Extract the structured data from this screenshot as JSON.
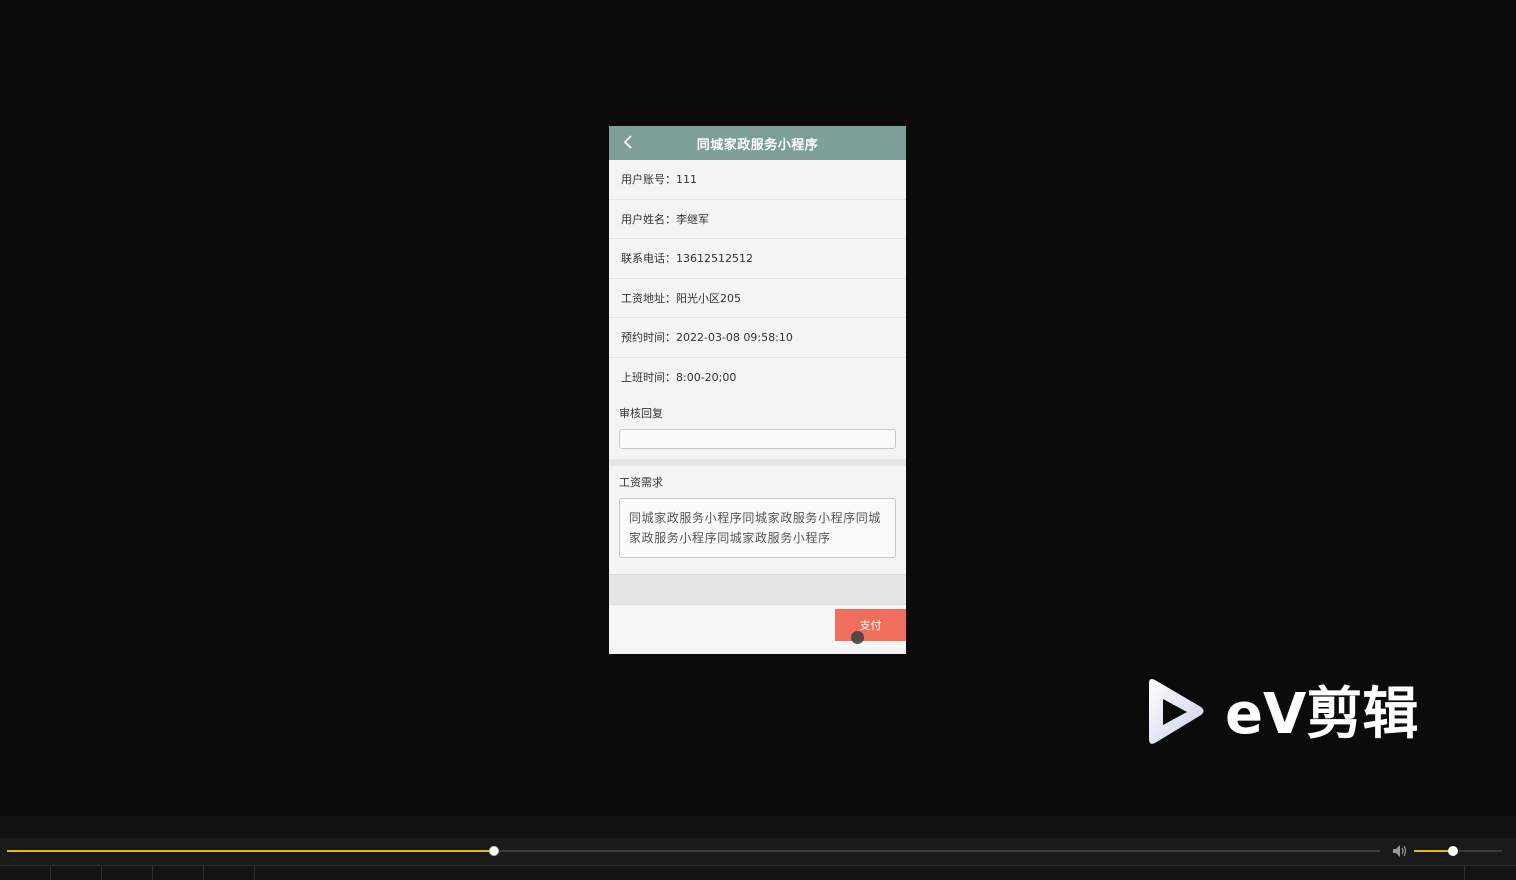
{
  "phone": {
    "title": "同城家政服务小程序",
    "fields": [
      {
        "label": "用户账号：",
        "value": "111"
      },
      {
        "label": "用户姓名：",
        "value": "李继军"
      },
      {
        "label": "联系电话：",
        "value": "13612512512"
      },
      {
        "label": "工资地址：",
        "value": "阳光小区205"
      },
      {
        "label": "预约时间：",
        "value": "2022-03-08 09:58:10"
      },
      {
        "label": "上班时间：",
        "value": "8:00-20;00"
      }
    ],
    "reply": {
      "label": "审核回复",
      "value": ""
    },
    "demand": {
      "label": "工资需求",
      "value": "同城家政服务小程序同城家政服务小程序同城家政服务小程序同城家政服务小程序"
    },
    "pay_label": "支付"
  },
  "logo": {
    "text": "eV剪辑"
  },
  "player": {
    "progress": 0.355,
    "volume": 0.44
  },
  "colors": {
    "nav": "#7e9e98",
    "pay_button": "#f26e5c",
    "accent": "#e6b800"
  },
  "icons": [
    "back-arrow-icon",
    "play-triangle-icon",
    "volume-icon"
  ]
}
